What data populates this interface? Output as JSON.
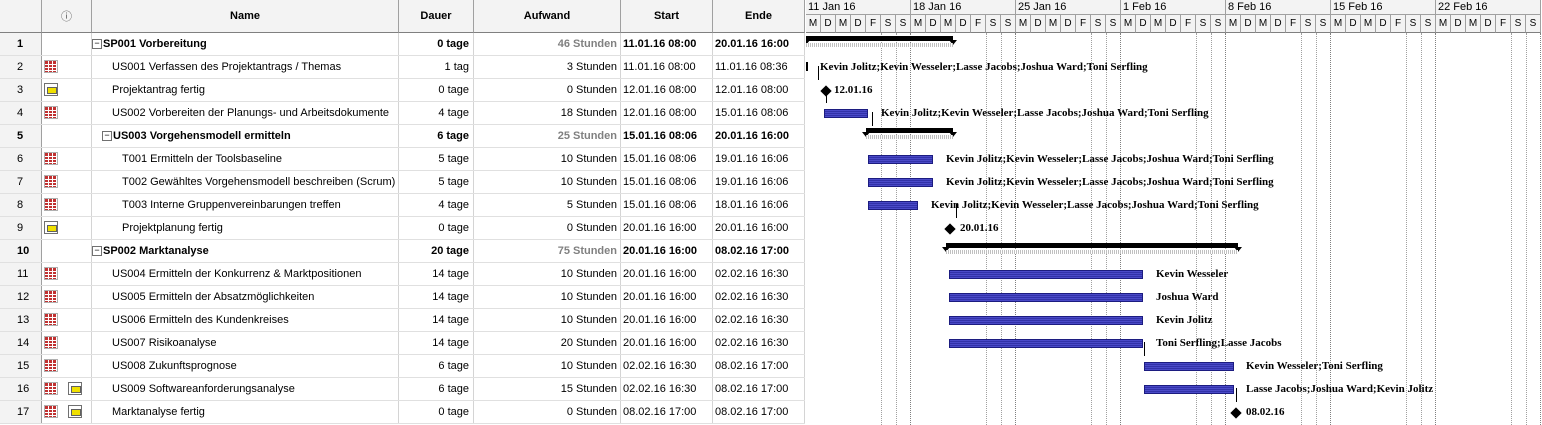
{
  "columns": {
    "info_icon": "ⓘ",
    "name": "Name",
    "dauer": "Dauer",
    "aufwand": "Aufwand",
    "start": "Start",
    "ende": "Ende"
  },
  "timescale": {
    "weeks": [
      "11 Jan 16",
      "18 Jan 16",
      "25 Jan 16",
      "1 Feb 16",
      "8 Feb 16",
      "15 Feb 16",
      "22 Feb 16"
    ],
    "days": [
      "M",
      "D",
      "M",
      "D",
      "F",
      "S",
      "S"
    ]
  },
  "rows": [
    {
      "id": "1",
      "name": "SP001 Vorbereitung",
      "dauer": "0 tage",
      "aufwand": "46 Stunden",
      "start": "11.01.16 08:00",
      "ende": "20.01.16 16:00",
      "summary": true,
      "collapse": "−",
      "icons": []
    },
    {
      "id": "2",
      "name": "US001 Verfassen des Projektantrags / Themas",
      "dauer": "1 tag",
      "aufwand": "3 Stunden",
      "start": "11.01.16 08:00",
      "ende": "11.01.16 08:36",
      "icons": [
        "calendar-icon"
      ]
    },
    {
      "id": "3",
      "name": "Projektantrag fertig",
      "dauer": "0 tage",
      "aufwand": "0 Stunden",
      "start": "12.01.16 08:00",
      "ende": "12.01.16 08:00",
      "icons": [
        "note-icon"
      ]
    },
    {
      "id": "4",
      "name": "US002 Vorbereiten der Planungs- und Arbeitsdokumente",
      "dauer": "4 tage",
      "aufwand": "18 Stunden",
      "start": "12.01.16 08:00",
      "ende": "15.01.16 08:06",
      "icons": [
        "calendar-icon"
      ]
    },
    {
      "id": "5",
      "name": "US003 Vorgehensmodell ermitteln",
      "dauer": "6 tage",
      "aufwand": "25 Stunden",
      "start": "15.01.16 08:06",
      "ende": "20.01.16 16:00",
      "summary": true,
      "collapse": "−",
      "icons": []
    },
    {
      "id": "6",
      "name": "T001 Ermitteln der Toolsbaseline",
      "dauer": "5 tage",
      "aufwand": "10 Stunden",
      "start": "15.01.16 08:06",
      "ende": "19.01.16 16:06",
      "icons": [
        "calendar-icon"
      ]
    },
    {
      "id": "7",
      "name": "T002 Gewähltes Vorgehensmodell beschreiben (Scrum)",
      "dauer": "5 tage",
      "aufwand": "10 Stunden",
      "start": "15.01.16 08:06",
      "ende": "19.01.16 16:06",
      "icons": [
        "calendar-icon"
      ]
    },
    {
      "id": "8",
      "name": "T003 Interne Gruppenvereinbarungen treffen",
      "dauer": "4 tage",
      "aufwand": "5 Stunden",
      "start": "15.01.16 08:06",
      "ende": "18.01.16 16:06",
      "icons": [
        "calendar-icon"
      ]
    },
    {
      "id": "9",
      "name": "Projektplanung fertig",
      "dauer": "0 tage",
      "aufwand": "0 Stunden",
      "start": "20.01.16 16:00",
      "ende": "20.01.16 16:00",
      "icons": [
        "note-icon"
      ]
    },
    {
      "id": "10",
      "name": "SP002 Marktanalyse",
      "dauer": "20 tage",
      "aufwand": "75 Stunden",
      "start": "20.01.16 16:00",
      "ende": "08.02.16 17:00",
      "summary": true,
      "collapse": "−",
      "icons": []
    },
    {
      "id": "11",
      "name": "US004 Ermitteln der Konkurrenz & Marktpositionen",
      "dauer": "14 tage",
      "aufwand": "10 Stunden",
      "start": "20.01.16 16:00",
      "ende": "02.02.16 16:30",
      "icons": [
        "calendar-icon"
      ]
    },
    {
      "id": "12",
      "name": "US005 Ermitteln der Absatzmöglichkeiten",
      "dauer": "14 tage",
      "aufwand": "10 Stunden",
      "start": "20.01.16 16:00",
      "ende": "02.02.16 16:30",
      "icons": [
        "calendar-icon"
      ]
    },
    {
      "id": "13",
      "name": "US006 Ermitteln des Kundenkreises",
      "dauer": "14 tage",
      "aufwand": "10 Stunden",
      "start": "20.01.16 16:00",
      "ende": "02.02.16 16:30",
      "icons": [
        "calendar-icon"
      ]
    },
    {
      "id": "14",
      "name": "US007 Risikoanalyse",
      "dauer": "14 tage",
      "aufwand": "20 Stunden",
      "start": "20.01.16 16:00",
      "ende": "02.02.16 16:30",
      "icons": [
        "calendar-icon"
      ]
    },
    {
      "id": "15",
      "name": "US008 Zukunftsprognose",
      "dauer": "6 tage",
      "aufwand": "10 Stunden",
      "start": "02.02.16 16:30",
      "ende": "08.02.16 17:00",
      "icons": [
        "calendar-icon"
      ]
    },
    {
      "id": "16",
      "name": "US009 Softwareanforderungsanalyse",
      "dauer": "6 tage",
      "aufwand": "15 Stunden",
      "start": "02.02.16 16:30",
      "ende": "08.02.16 17:00",
      "icons": [
        "calendar-icon",
        "note-icon"
      ]
    },
    {
      "id": "17",
      "name": "Marktanalyse fertig",
      "dauer": "0 tage",
      "aufwand": "0 Stunden",
      "start": "08.02.16 17:00",
      "ende": "08.02.16 17:00",
      "icons": [
        "calendar-icon",
        "note-icon"
      ]
    }
  ],
  "gantt_labels": {
    "r2": "Kevin Jolitz;Kevin Wesseler;Lasse Jacobs;Joshua Ward;Toni Serfling",
    "r3": "12.01.16",
    "r4": "Kevin Jolitz;Kevin Wesseler;Lasse Jacobs;Joshua Ward;Toni Serfling",
    "r6": "Kevin Jolitz;Kevin Wesseler;Lasse Jacobs;Joshua Ward;Toni Serfling",
    "r7": "Kevin Jolitz;Kevin Wesseler;Lasse Jacobs;Joshua Ward;Toni Serfling",
    "r8": "Kevin Jolitz;Kevin Wesseler;Lasse Jacobs;Joshua Ward;Toni Serfling",
    "r9": "20.01.16",
    "r11": "Kevin Wesseler",
    "r12": "Joshua Ward",
    "r13": "Kevin Jolitz",
    "r14": "Toni Serfling;Lasse Jacobs",
    "r15": "Kevin Wesseler;Toni Serfling",
    "r16": "Lasse Jacobs;Joshua Ward;Kevin Jolitz",
    "r17": "08.02.16"
  },
  "colors": {
    "task_bar": "#3a3ab0",
    "summary_bar": "#000000",
    "header_bg": "#f3f3f3"
  }
}
